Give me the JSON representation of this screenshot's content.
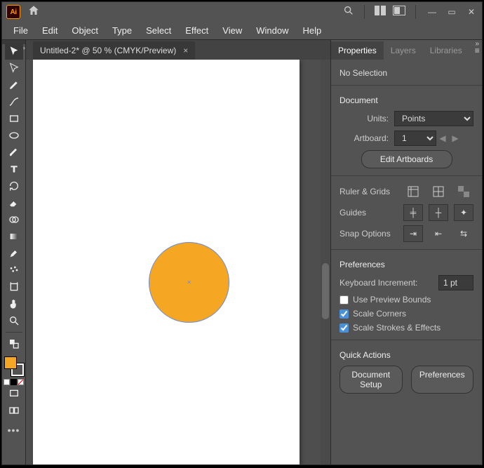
{
  "titlebar": {
    "badge": "Ai"
  },
  "menu": {
    "items": [
      "File",
      "Edit",
      "Object",
      "Type",
      "Select",
      "Effect",
      "View",
      "Window",
      "Help"
    ]
  },
  "doc_tab": {
    "label": "Untitled-2* @ 50 % (CMYK/Preview)"
  },
  "panel": {
    "tabs": [
      "Properties",
      "Layers",
      "Libraries"
    ],
    "active_tab": 0,
    "selection": "No Selection",
    "document_head": "Document",
    "units_label": "Units:",
    "units_value": "Points",
    "artboard_label": "Artboard:",
    "artboard_value": "1",
    "edit_artboards": "Edit Artboards",
    "ruler_grids": "Ruler & Grids",
    "guides": "Guides",
    "snap": "Snap Options",
    "preferences_head": "Preferences",
    "kbd_label": "Keyboard Increment:",
    "kbd_value": "1 pt",
    "chk_preview": "Use Preview Bounds",
    "chk_corners": "Scale Corners",
    "chk_strokes": "Scale Strokes & Effects",
    "quick_actions": "Quick Actions",
    "doc_setup": "Document Setup",
    "prefs_btn": "Preferences"
  },
  "checked": {
    "preview": false,
    "corners": true,
    "strokes": true
  },
  "canvas": {
    "fill": "#f5a623",
    "stroke": "#6a8dd8"
  }
}
